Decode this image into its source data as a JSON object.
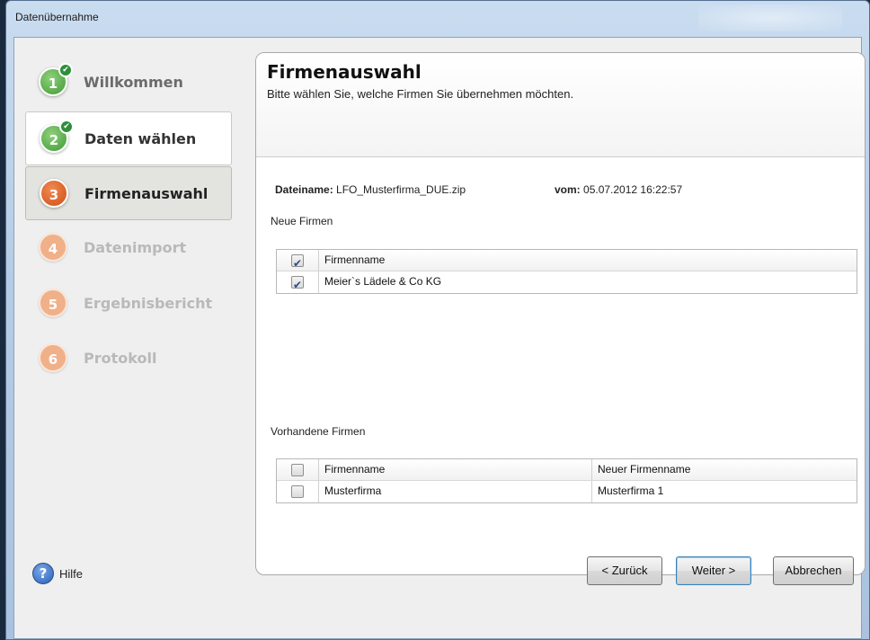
{
  "window": {
    "title": "Datenübernahme"
  },
  "steps": [
    {
      "number": "1",
      "label": "Willkommen",
      "state": "done"
    },
    {
      "number": "2",
      "label": "Daten wählen",
      "state": "done"
    },
    {
      "number": "3",
      "label": "Firmenauswahl",
      "state": "current"
    },
    {
      "number": "4",
      "label": "Datenimport",
      "state": "future"
    },
    {
      "number": "5",
      "label": "Ergebnisbericht",
      "state": "future"
    },
    {
      "number": "6",
      "label": "Protokoll",
      "state": "future"
    }
  ],
  "header": {
    "title": "Firmenauswahl",
    "subtitle": "Bitte wählen Sie, welche Firmen Sie übernehmen möchten."
  },
  "file": {
    "name_label": "Dateiname:",
    "name_value": "LFO_Musterfirma_DUE.zip",
    "date_label": "vom:",
    "date_value": "05.07.2012 16:22:57"
  },
  "new_companies": {
    "label": "Neue Firmen",
    "header": {
      "col1": "Firmenname",
      "checked": true
    },
    "rows": [
      {
        "name": "Meier`s Lädele & Co KG",
        "checked": true
      }
    ]
  },
  "existing_companies": {
    "label": "Vorhandene Firmen",
    "header": {
      "col1": "Firmenname",
      "col2": "Neuer Firmenname",
      "checked": false
    },
    "rows": [
      {
        "name": "Musterfirma",
        "new_name": "Musterfirma 1",
        "checked": false
      }
    ]
  },
  "footer": {
    "help_label": "Hilfe",
    "back_label": "< Zurück",
    "next_label": "Weiter >",
    "cancel_label": "Abbrechen"
  },
  "colors": {
    "step_done": "#3f9a36",
    "step_current": "#d04e14",
    "step_future": "#f0b089"
  },
  "icons": {
    "help": "question-mark-icon",
    "done": "checkmark-icon"
  }
}
